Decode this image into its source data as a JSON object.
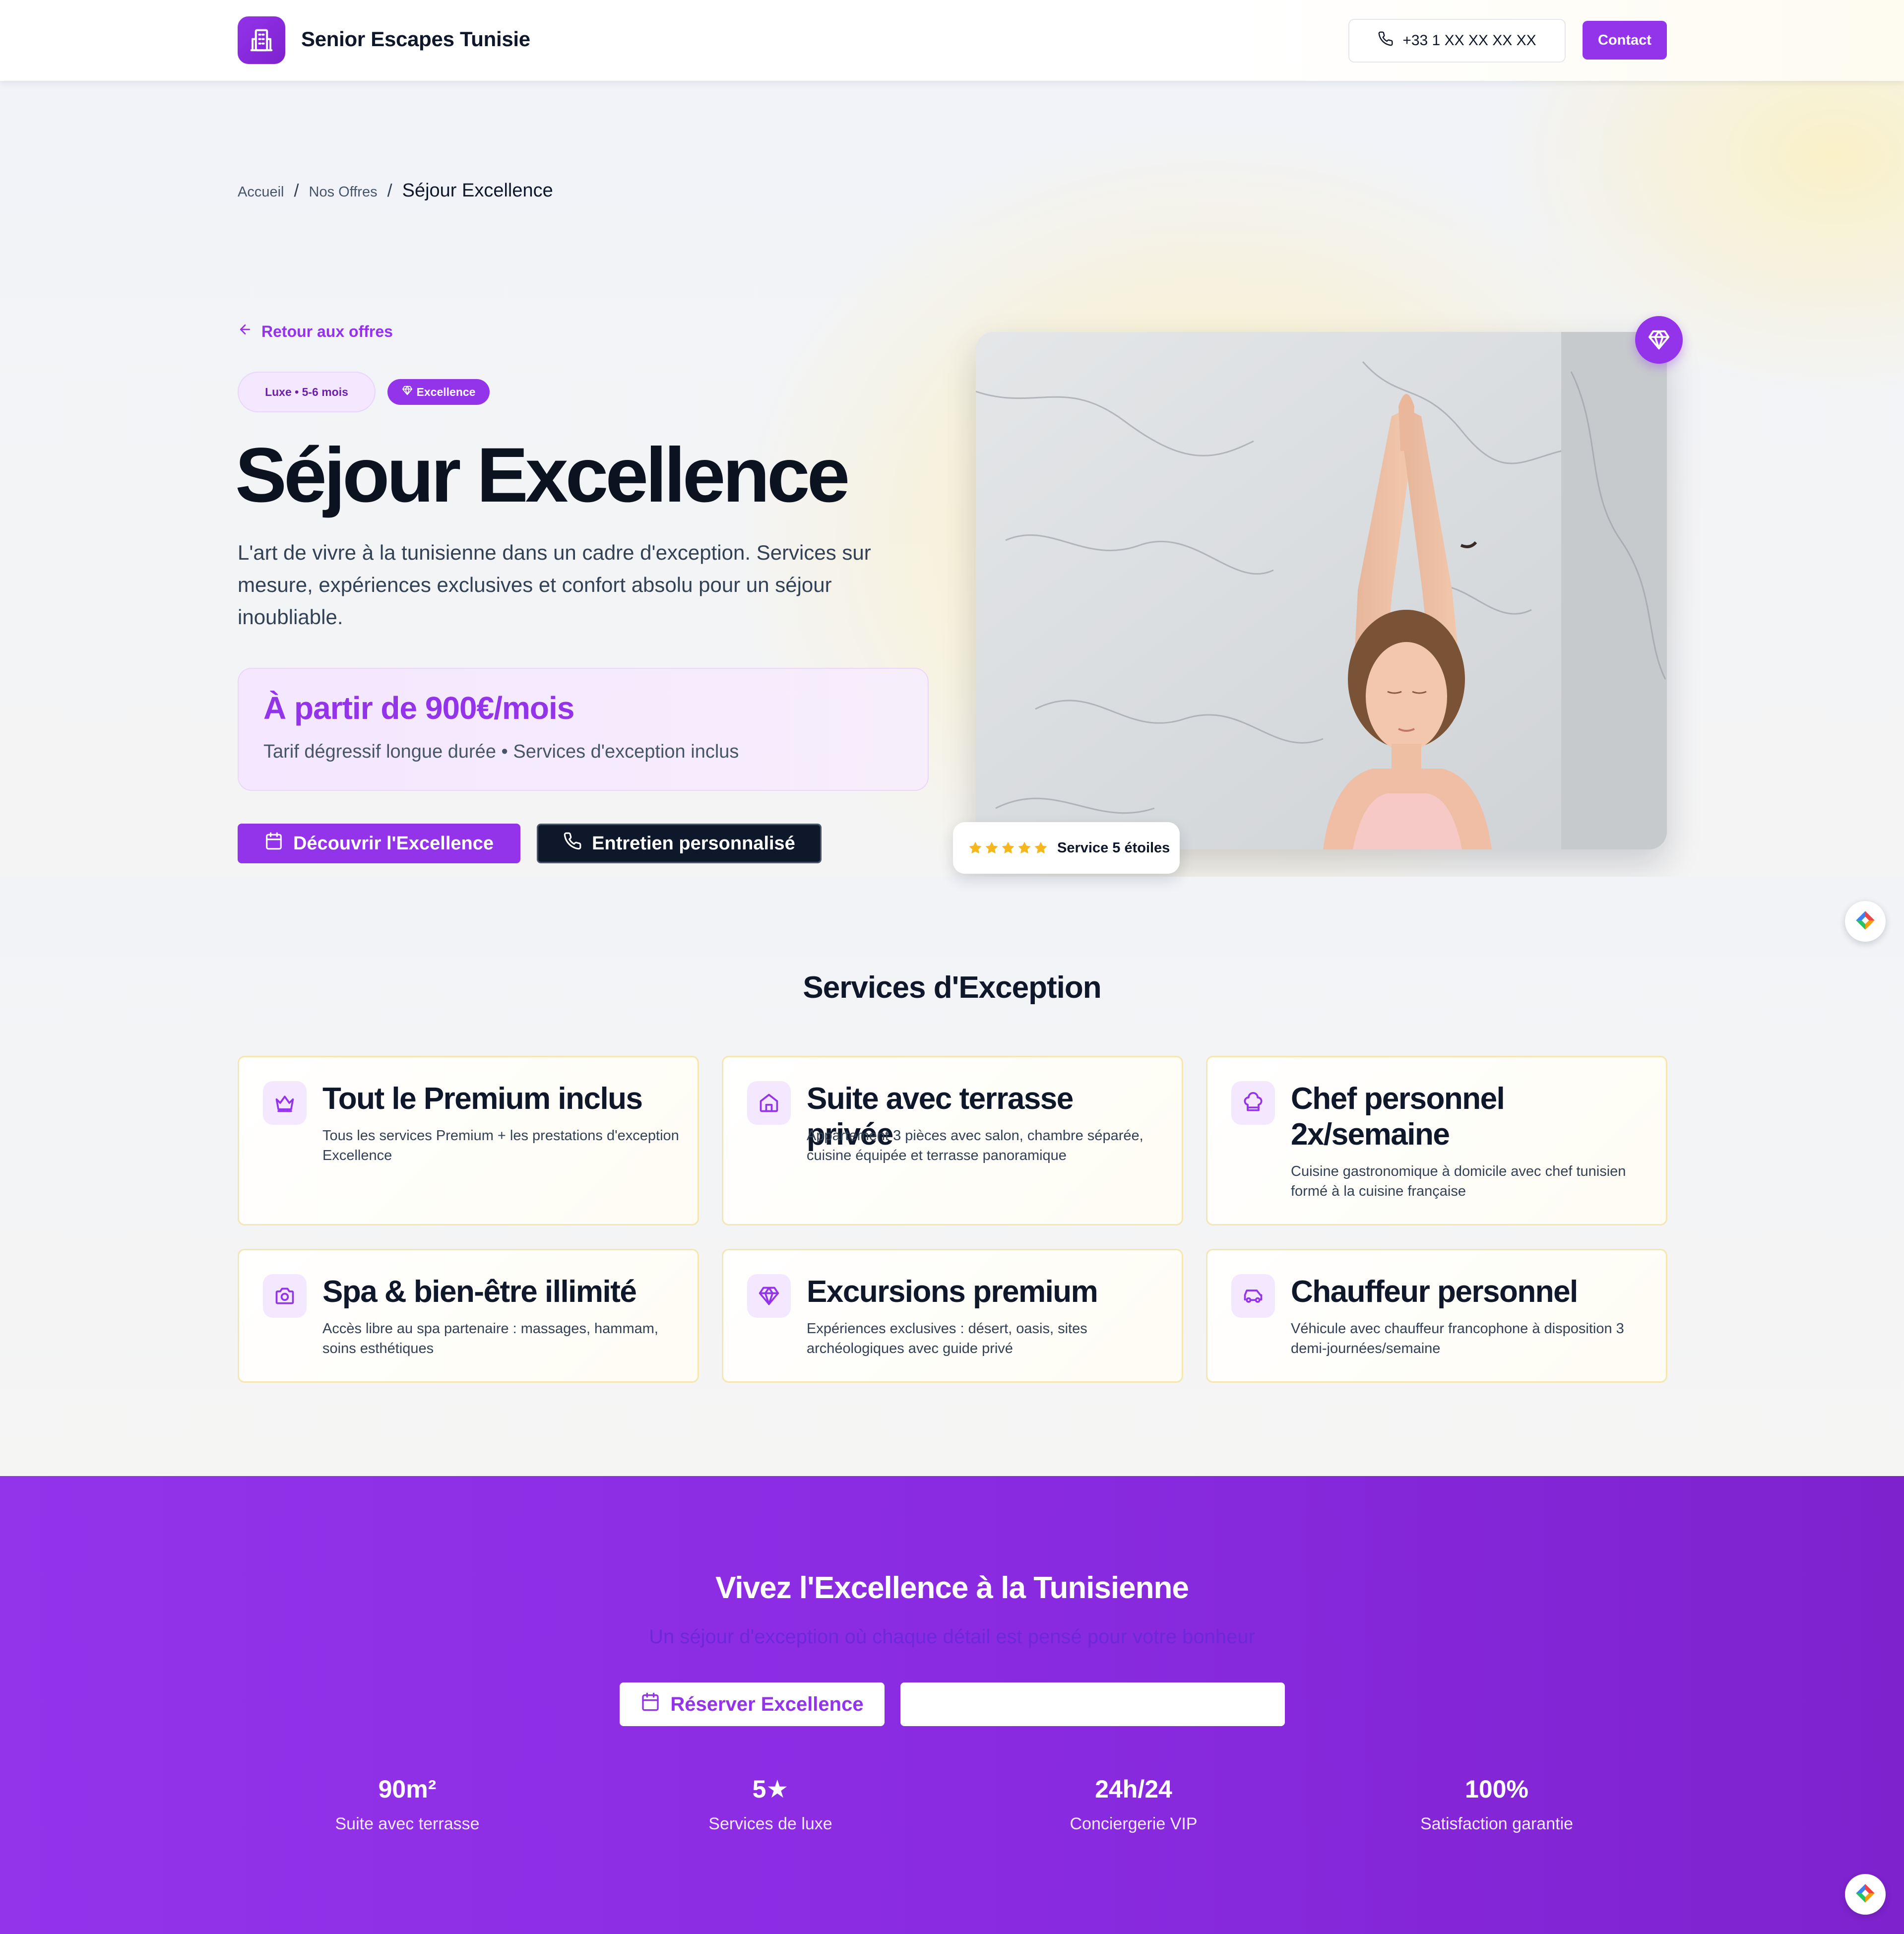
{
  "header": {
    "brand": "Senior Escapes Tunisie",
    "phone": "+33 1 XX XX XX XX",
    "contact_label": "Contact"
  },
  "breadcrumb": {
    "items": [
      "Accueil",
      "Nos Offres"
    ],
    "separator": "/",
    "current": "Séjour Excellence"
  },
  "hero": {
    "back_label": "Retour aux offres",
    "pill_duration": "Luxe • 5-6 mois",
    "pill_tier": "Excellence",
    "title": "Séjour Excellence",
    "description": "L'art de vivre à la tunisienne dans un cadre d'exception. Services sur mesure, expériences exclusives et confort absolu pour un séjour inoubliable.",
    "price_title": "À partir de 900€/mois",
    "price_sub": "Tarif dégressif longue durée • Services d'exception inclus",
    "cta_primary": "Découvrir l'Excellence",
    "cta_secondary": "Entretien personnalisé",
    "rating_label": "Service 5 étoiles",
    "rating_stars": 5
  },
  "services": {
    "title": "Services d'Exception",
    "items": [
      {
        "icon": "crown-icon",
        "title": "Tout le Premium inclus",
        "desc": "Tous les services Premium + les prestations d'exception Excellence"
      },
      {
        "icon": "home-icon",
        "title": "Suite avec terrasse privée",
        "desc": "Appartement 3 pièces avec salon, chambre séparée, cuisine équipée et terrasse panoramique"
      },
      {
        "icon": "chef-hat-icon",
        "title": "Chef personnel 2x/semaine",
        "desc": "Cuisine gastronomique à domicile avec chef tunisien formé à la cuisine française"
      },
      {
        "icon": "camera-icon",
        "title": "Spa & bien-être illimité",
        "desc": "Accès libre au spa partenaire : massages, hammam, soins esthétiques"
      },
      {
        "icon": "gem-icon",
        "title": "Excursions premium",
        "desc": "Expériences exclusives : désert, oasis, sites archéologiques avec guide privé"
      },
      {
        "icon": "car-icon",
        "title": "Chauffeur personnel",
        "desc": "Véhicule avec chauffeur francophone à disposition 3 demi-journées/semaine"
      }
    ]
  },
  "band": {
    "title": "Vivez l'Excellence à la Tunisienne",
    "subtitle": "Un séjour d'exception où chaque détail est pensé pour votre bonheur",
    "reserve_label": "Réserver Excellence",
    "stats": [
      {
        "value": "90m²",
        "label": "Suite avec terrasse"
      },
      {
        "value": "5★",
        "label": "Services de luxe"
      },
      {
        "value": "24h/24",
        "label": "Conciergerie VIP"
      },
      {
        "value": "100%",
        "label": "Satisfaction garantie"
      }
    ]
  },
  "colors": {
    "accent": "#9333ea",
    "dark": "#0f172a",
    "star": "#f5b71c",
    "card_border": "#f5e6b3"
  }
}
